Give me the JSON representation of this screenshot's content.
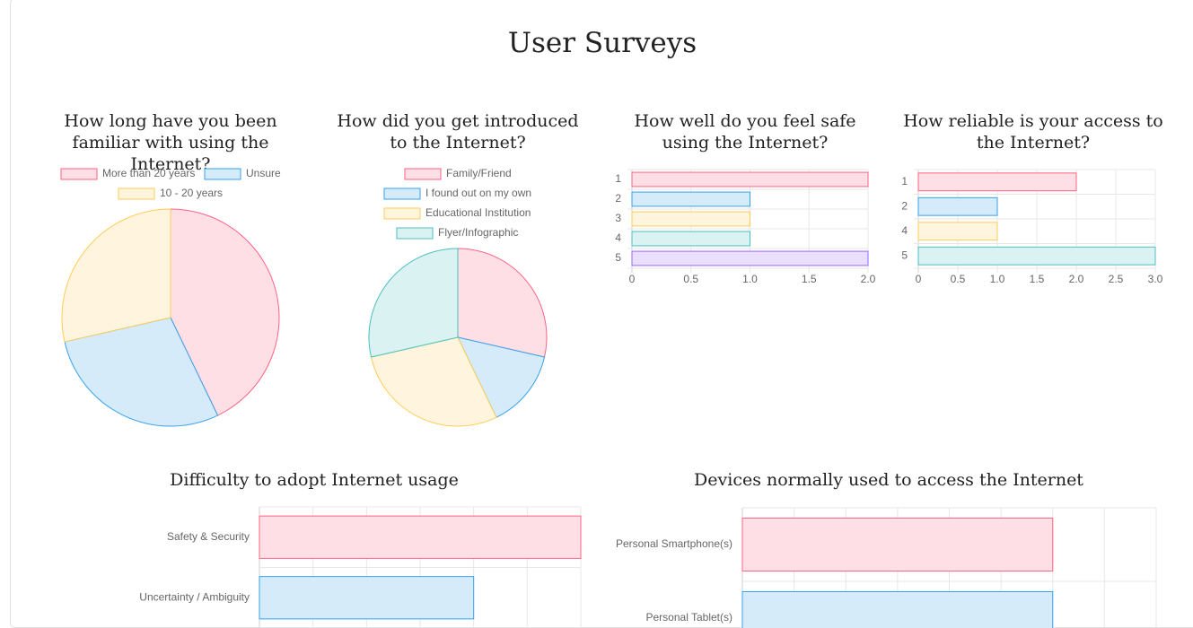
{
  "page": {
    "title": "User Surveys"
  },
  "colors": {
    "pink": {
      "fill": "#ffdfe6",
      "stroke": "#ff6384"
    },
    "blue": {
      "fill": "#d6ebf9",
      "stroke": "#36a2eb"
    },
    "yellow": {
      "fill": "#fff4dd",
      "stroke": "#ffcd56"
    },
    "teal": {
      "fill": "#daf2f2",
      "stroke": "#4bc0c0"
    },
    "purple": {
      "fill": "#ebdfff",
      "stroke": "#9966ff"
    }
  },
  "chart_data": [
    {
      "id": "familiarity",
      "type": "pie",
      "title": "How long have you been familiar with using the Internet?",
      "labels": [
        "More than 20 years",
        "Unsure",
        "10 - 20 years"
      ],
      "values": [
        3,
        2,
        2
      ],
      "legend": "top"
    },
    {
      "id": "introduced",
      "type": "pie",
      "title": "How did you get introduced to the Internet?",
      "labels": [
        "Family/Friend",
        "I found out on my own",
        "Educational Institution",
        "Flyer/Infographic"
      ],
      "values": [
        2,
        1,
        2,
        2
      ],
      "legend": "top"
    },
    {
      "id": "safety",
      "type": "bar",
      "orientation": "horizontal",
      "title": "How well do you feel safe using the Internet?",
      "categories": [
        "1",
        "2",
        "3",
        "4",
        "5"
      ],
      "values": [
        2,
        1,
        1,
        1,
        2
      ],
      "xlim": [
        0,
        2
      ],
      "xticks": [
        "0",
        "0.5",
        "1.0",
        "1.5",
        "2.0"
      ],
      "grid": true
    },
    {
      "id": "reliability",
      "type": "bar",
      "orientation": "horizontal",
      "title": "How reliable is your access to the Internet?",
      "categories": [
        "1",
        "2",
        "4",
        "5"
      ],
      "values": [
        2,
        1,
        1,
        3
      ],
      "xlim": [
        0,
        3
      ],
      "xticks": [
        "0",
        "0.5",
        "1.0",
        "1.5",
        "2.0",
        "2.5",
        "3.0"
      ],
      "grid": true
    },
    {
      "id": "difficulty",
      "type": "bar",
      "orientation": "horizontal",
      "title": "Difficulty to adopt Internet usage",
      "categories": [
        "Safety & Security",
        "Uncertainty / Ambiguity"
      ],
      "values": [
        3,
        2
      ],
      "xlim": [
        0,
        3
      ],
      "grid": true
    },
    {
      "id": "devices",
      "type": "bar",
      "orientation": "horizontal",
      "title": "Devices normally used to access the Internet",
      "categories": [
        "Personal Smartphone(s)",
        "Personal Tablet(s)"
      ],
      "values": [
        6,
        6
      ],
      "xlim": [
        0,
        8
      ],
      "grid": true
    }
  ]
}
